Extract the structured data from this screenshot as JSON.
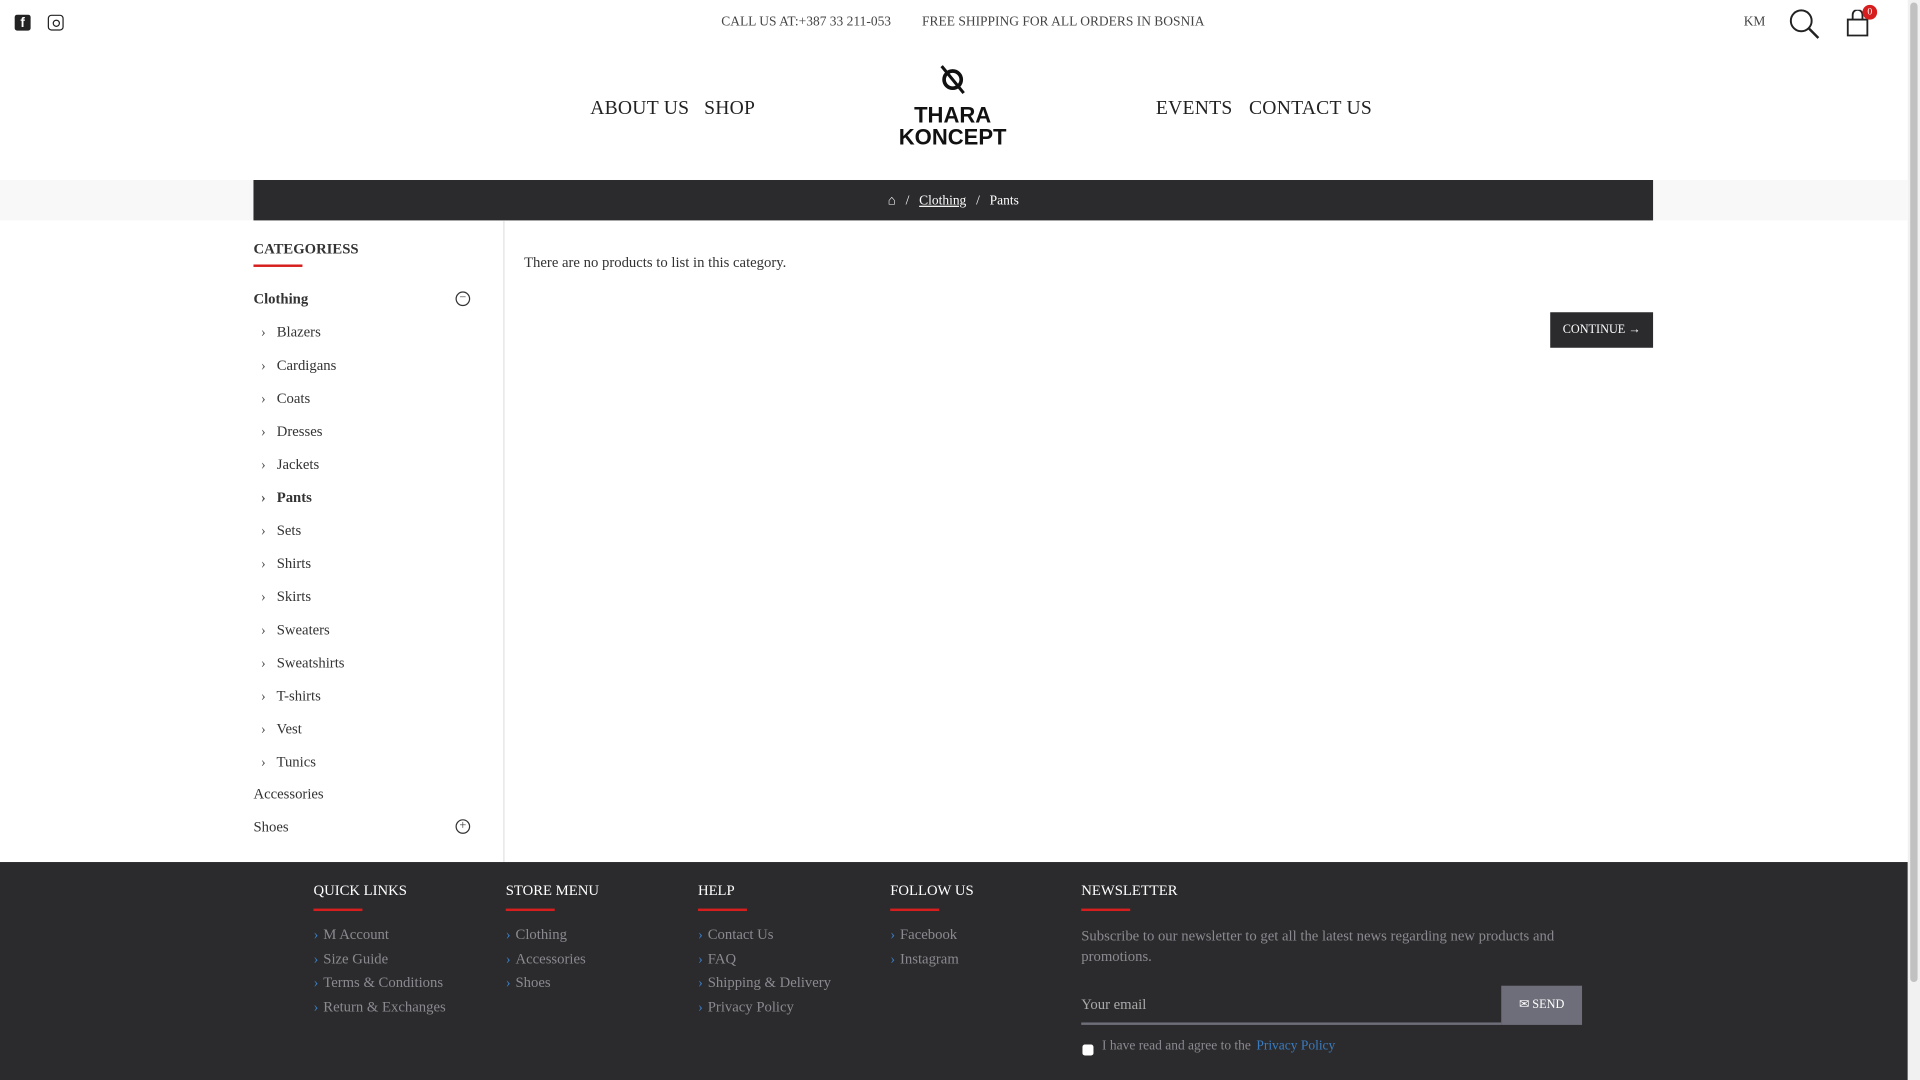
{
  "topbar": {
    "call": "CALL US AT:+387 33 211-053",
    "shipping": "FREE SHIPPING FOR ALL ORDERS IN BOSNIA",
    "currency": "KM",
    "cart_count": "0"
  },
  "nav": {
    "about": "ABOUT US",
    "shop": "SHOP",
    "events": "EVENTS",
    "contact": "CONTACT US"
  },
  "logo": {
    "line1": "THARA",
    "line2": "KONCEPT"
  },
  "breadcrumb": {
    "sep": "/",
    "clothing": "Clothing",
    "current": "Pants"
  },
  "sidebar": {
    "title": "CATEGORIESS",
    "clothing": "Clothing",
    "subs": [
      "Blazers",
      "Cardigans",
      "Coats",
      "Dresses",
      "Jackets",
      "Pants",
      "Sets",
      "Shirts",
      "Skirts",
      "Sweaters",
      "Sweatshirts",
      "T-shirts",
      "Vest",
      "Tunics"
    ],
    "accessories": "Accessories",
    "shoes": "Shoes"
  },
  "main": {
    "empty": "There are no products to list in this category.",
    "continue": "CONTINUE"
  },
  "footer": {
    "quick": {
      "title": "QUICK LINKS",
      "items": [
        "M Account",
        "Size Guide",
        "Terms & Conditions",
        "Return & Exchanges"
      ]
    },
    "store": {
      "title": "STORE MENU",
      "items": [
        "Clothing",
        "Accessories",
        "Shoes"
      ]
    },
    "help": {
      "title": "HELP",
      "items": [
        "Contact Us",
        "FAQ",
        "Shipping & Delivery",
        "Privacy Policy"
      ]
    },
    "follow": {
      "title": "FOLLOW US",
      "items": [
        "Facebook",
        "Instagram"
      ]
    },
    "newsletter": {
      "title": "NEWSLETTER",
      "text": "Subscribe to our newsletter to get all the latest news regarding new products and promotions.",
      "placeholder": "Your email",
      "send": "SEND",
      "agree": "I have read and agree to the",
      "policy": "Privacy Policy"
    }
  }
}
